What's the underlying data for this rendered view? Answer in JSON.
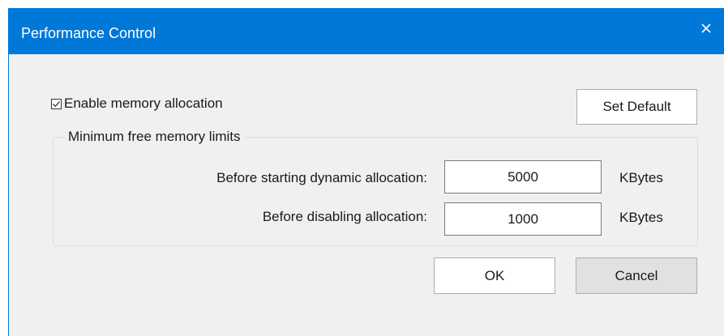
{
  "window": {
    "title": "Performance Control",
    "close_symbol": "×",
    "accent_color": "#0078d7"
  },
  "checkbox": {
    "label": "Enable memory allocation",
    "checked": true
  },
  "buttons": {
    "set_default": "Set Default",
    "ok": "OK",
    "cancel": "Cancel"
  },
  "group": {
    "legend": "Minimum free memory limits",
    "fields": [
      {
        "label": "Before starting dynamic allocation:",
        "value": "5000",
        "unit": "KBytes"
      },
      {
        "label": "Before disabling allocation:",
        "value": "1000",
        "unit": "KBytes"
      }
    ]
  },
  "icons": {
    "close": "close-icon",
    "check": "checkmark-icon"
  }
}
